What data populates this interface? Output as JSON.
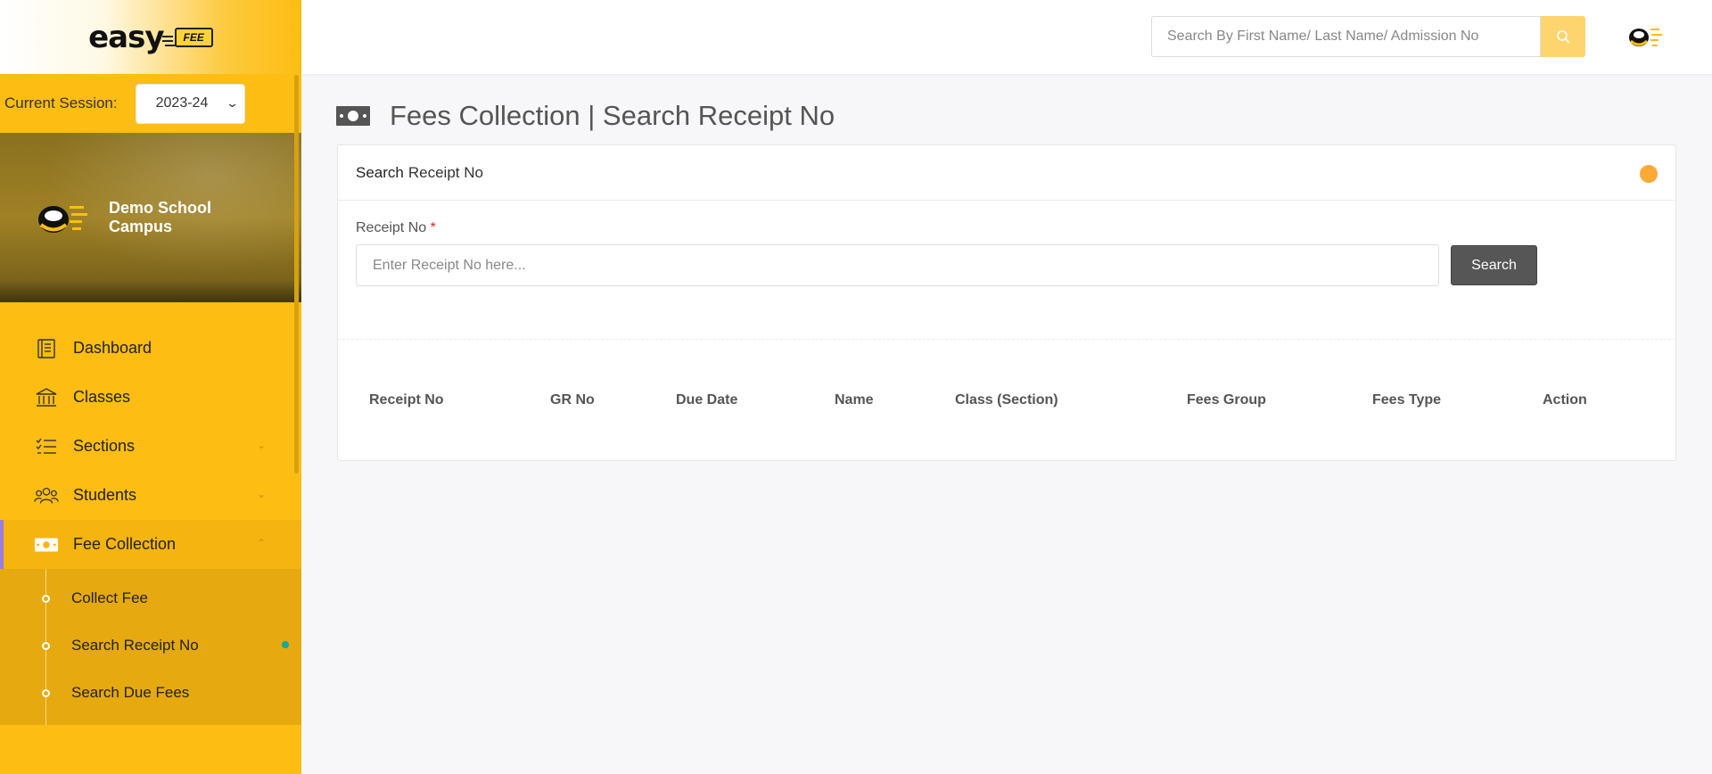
{
  "brand": {
    "logo_text": "easy",
    "badge_text": "FEE"
  },
  "session": {
    "label": "Current Session:",
    "selected": "2023-24"
  },
  "campus": {
    "name": "Demo School Campus"
  },
  "menu": {
    "items": [
      {
        "label": "Dashboard",
        "icon": "dashboard-icon"
      },
      {
        "label": "Classes",
        "icon": "building-icon"
      },
      {
        "label": "Sections",
        "icon": "list-icon",
        "has_children": true
      },
      {
        "label": "Students",
        "icon": "users-icon",
        "has_children": true
      },
      {
        "label": "Fee Collection",
        "icon": "money-icon",
        "expanded": true
      }
    ],
    "sub_items": [
      {
        "label": "Collect Fee"
      },
      {
        "label": "Search Receipt No",
        "active": true
      },
      {
        "label": "Search Due Fees"
      }
    ]
  },
  "header": {
    "search_placeholder": "Search By First Name/ Last Name/ Admission No"
  },
  "page": {
    "title": "Fees Collection | Search Receipt No",
    "card": {
      "title_bold": "Search",
      "title_rest": "Receipt No",
      "field_label": "Receipt No",
      "required_mark": "*",
      "input_placeholder": "Enter Receipt No here...",
      "search_button": "Search"
    },
    "table": {
      "columns": [
        "Receipt No",
        "GR No",
        "Due Date",
        "Name",
        "Class (Section)",
        "Fees Group",
        "Fees Type",
        "Action"
      ]
    }
  },
  "colors": {
    "sidebar": "#fdbd12",
    "sidebar_submenu": "#e6a90f",
    "accent_orange": "#fda937",
    "button_dark": "#565656",
    "active_indicator": "#16a89a"
  }
}
